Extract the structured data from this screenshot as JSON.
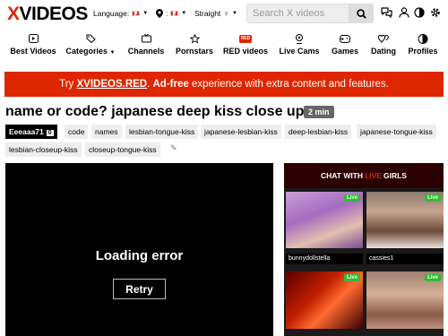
{
  "header": {
    "logo_x": "X",
    "logo_rest": "VIDEOS",
    "language_label": "Language:",
    "straight_label": "Straight",
    "search_placeholder": "Search X videos"
  },
  "nav": {
    "items": [
      {
        "label": "Best Videos",
        "icon": "play-icon"
      },
      {
        "label": "Categories",
        "icon": "tag-icon"
      },
      {
        "label": "Channels",
        "icon": "tv-icon"
      },
      {
        "label": "Pornstars",
        "icon": "star-icon"
      },
      {
        "label": "RED videos",
        "icon": "red-badge"
      },
      {
        "label": "Live Cams",
        "icon": "webcam-icon"
      },
      {
        "label": "Games",
        "icon": "gamepad-icon"
      },
      {
        "label": "Dating",
        "icon": "hearts-icon"
      },
      {
        "label": "Profiles",
        "icon": "profiles-icon"
      }
    ],
    "red_badge": "RED"
  },
  "promo": {
    "try": "Try",
    "brand": "XVIDEOS.RED",
    "adfree": "Ad-free",
    "rest": "experience with extra content and features."
  },
  "video": {
    "title": "name or code? japanese deep kiss close up",
    "duration": "2 min",
    "uploader": "Eeeaaa71",
    "uploader_count": "0",
    "tags": [
      "code",
      "names",
      "lesbian-tongue-kiss",
      "japanese-lesbian-kiss",
      "deep-lesbian-kiss",
      "japanese-tongue-kiss",
      "lesbian-closeup-kiss",
      "closeup-tongue-kiss"
    ]
  },
  "player": {
    "error_text": "Loading error",
    "retry_label": "Retry"
  },
  "chat": {
    "header_pre": "CHAT WITH",
    "header_live": "LIVE",
    "header_post": "GIRLS",
    "live_badge": "Live",
    "cams": [
      {
        "name": "bunnydollstella"
      },
      {
        "name": "cassies1"
      },
      {
        "name": ""
      },
      {
        "name": ""
      }
    ]
  },
  "colors": {
    "accent": "#de2600",
    "live_green": "#2fbd2f"
  }
}
